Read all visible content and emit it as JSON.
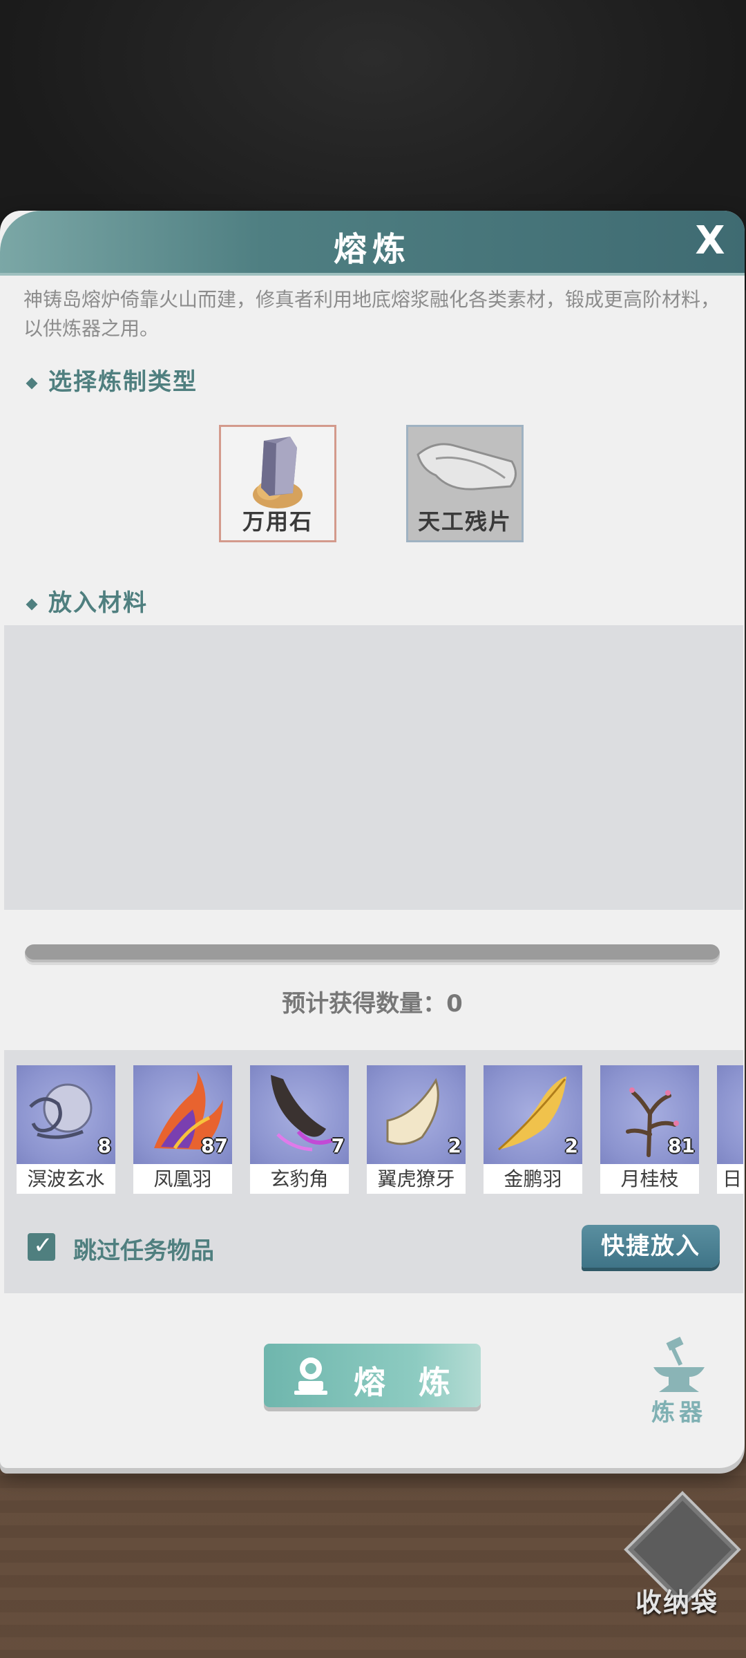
{
  "window": {
    "title": "熔炼",
    "close": "X"
  },
  "description": "神铸岛熔炉倚靠火山而建，修真者利用地底熔浆融化各类素材，锻成更高阶材料，以供炼器之用。",
  "sections": {
    "type_heading": "选择炼制类型",
    "material_heading": "放入材料"
  },
  "types": [
    {
      "label": "万用石",
      "selected": true
    },
    {
      "label": "天工残片",
      "selected": false
    }
  ],
  "progress": {
    "fraction": 0
  },
  "expected": "预计获得数量：0",
  "inventory": [
    {
      "name": "溟波玄水",
      "count": "8",
      "icon": "water-orb-icon"
    },
    {
      "name": "凤凰羽",
      "count": "87",
      "icon": "phoenix-feather-icon"
    },
    {
      "name": "玄豹角",
      "count": "7",
      "icon": "leopard-horn-icon"
    },
    {
      "name": "翼虎獠牙",
      "count": "2",
      "icon": "tiger-fang-icon"
    },
    {
      "name": "金鹏羽",
      "count": "2",
      "icon": "golden-feather-icon"
    },
    {
      "name": "月桂枝",
      "count": "81",
      "icon": "laurel-branch-icon"
    },
    {
      "name": "日",
      "count": "",
      "icon": "partial-item-icon"
    }
  ],
  "options": {
    "skip_label": "跳过任务物品",
    "skip_checked": true
  },
  "buttons": {
    "quick": "快捷放入",
    "smelt": "熔 炼",
    "forge": "炼器",
    "bag": "收纳袋"
  },
  "colors": {
    "accent": "#4f7f7f",
    "title_bar": "#4f7f82",
    "item_bg": "#8c94cf"
  }
}
